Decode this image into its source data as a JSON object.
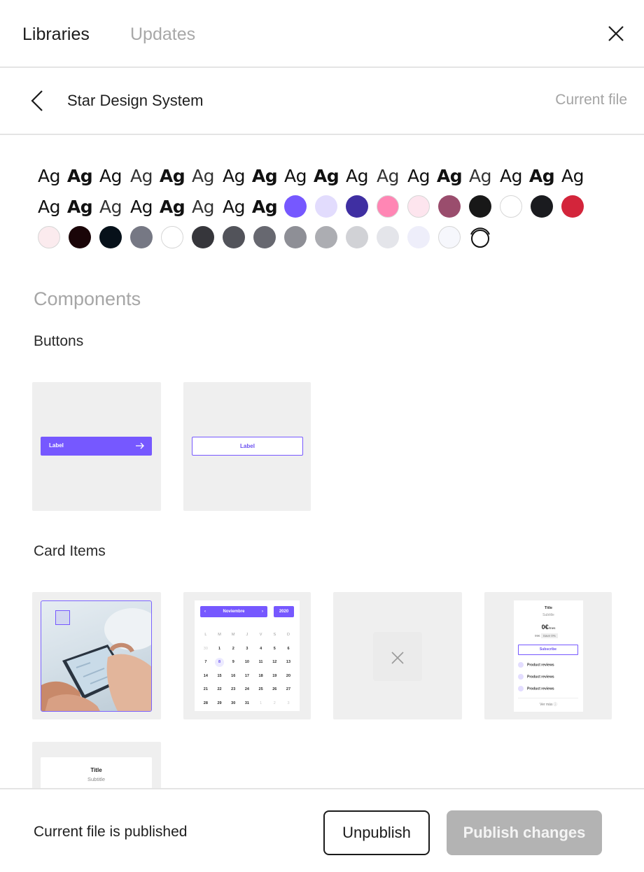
{
  "header": {
    "tabs": [
      {
        "label": "Libraries",
        "active": true
      },
      {
        "label": "Updates",
        "active": false
      }
    ],
    "close_icon": "close-icon"
  },
  "library": {
    "back_icon": "chevron-left-icon",
    "title": "Star Design System",
    "scope_label": "Current file"
  },
  "styles": {
    "text_styles": [
      {
        "sample": "Ag",
        "weight": "normal"
      },
      {
        "sample": "Ag",
        "weight": "bold"
      },
      {
        "sample": "Ag",
        "weight": "normal"
      },
      {
        "sample": "Ag",
        "weight": "light"
      },
      {
        "sample": "Ag",
        "weight": "bold"
      },
      {
        "sample": "Ag",
        "weight": "light"
      },
      {
        "sample": "Ag",
        "weight": "normal"
      },
      {
        "sample": "Ag",
        "weight": "bold"
      },
      {
        "sample": "Ag",
        "weight": "normal"
      },
      {
        "sample": "Ag",
        "weight": "bold"
      },
      {
        "sample": "Ag",
        "weight": "normal"
      },
      {
        "sample": "Ag",
        "weight": "light"
      },
      {
        "sample": "Ag",
        "weight": "normal"
      },
      {
        "sample": "Ag",
        "weight": "bold"
      },
      {
        "sample": "Ag",
        "weight": "light"
      },
      {
        "sample": "Ag",
        "weight": "normal"
      },
      {
        "sample": "Ag",
        "weight": "bold"
      },
      {
        "sample": "Ag",
        "weight": "normal"
      },
      {
        "sample": "Ag",
        "weight": "normal"
      },
      {
        "sample": "Ag",
        "weight": "bold"
      },
      {
        "sample": "Ag",
        "weight": "light"
      },
      {
        "sample": "Ag",
        "weight": "normal"
      },
      {
        "sample": "Ag",
        "weight": "bold"
      },
      {
        "sample": "Ag",
        "weight": "light"
      },
      {
        "sample": "Ag",
        "weight": "normal"
      },
      {
        "sample": "Ag",
        "weight": "bold"
      }
    ],
    "color_styles": [
      "#7658ff",
      "#e2dcfd",
      "#3f2fa2",
      "#ff86b4",
      "#fde5ee",
      "#9a4d6d",
      "#181818",
      "#ffffff",
      "#1a1b1f",
      "#d3253b",
      "#fbebee",
      "#1a0508",
      "#07111a",
      "#767884",
      "#ffffff",
      "#36363b",
      "#52535a",
      "#676870",
      "#8e8f96",
      "#acadb2",
      "#d1d2d6",
      "#e4e5ea",
      "#eeeefa",
      "#f6f7fc"
    ],
    "effect_style_icon": "effect-style-icon"
  },
  "components": {
    "heading": "Components",
    "groups": [
      {
        "name": "Buttons",
        "items": [
          {
            "kind": "button-filled",
            "label": "Label"
          },
          {
            "kind": "button-outline",
            "label": "Label"
          }
        ]
      },
      {
        "name": "Card Items",
        "items": [
          {
            "kind": "photo-card"
          },
          {
            "kind": "calendar",
            "month": "Noviembre",
            "year": "2020",
            "weekdays": [
              "L",
              "M",
              "M",
              "J",
              "V",
              "S",
              "D"
            ],
            "weeks": [
              [
                "30",
                "1",
                "2",
                "3",
                "4",
                "5",
                "6"
              ],
              [
                "7",
                "8",
                "9",
                "10",
                "11",
                "12",
                "13"
              ],
              [
                "14",
                "15",
                "16",
                "17",
                "18",
                "19",
                "20"
              ],
              [
                "21",
                "22",
                "23",
                "24",
                "25",
                "26",
                "27"
              ],
              [
                "28",
                "29",
                "30",
                "31",
                "1",
                "2",
                "3"
              ]
            ]
          },
          {
            "kind": "empty"
          },
          {
            "kind": "pricing",
            "title": "Title",
            "subtitle": "Subtitle",
            "price": "0€",
            "period": "/mes",
            "old_price": "99€",
            "save": "Save 0%",
            "cta": "Subscribe",
            "features": [
              "Product reviews",
              "Product reviews",
              "Product reviews"
            ],
            "more": "Ver más"
          },
          {
            "kind": "title-card",
            "title": "Title",
            "subtitle": "Subtitle"
          }
        ]
      }
    ]
  },
  "footer": {
    "status": "Current file is published",
    "unpublish_label": "Unpublish",
    "publish_label": "Publish changes"
  }
}
